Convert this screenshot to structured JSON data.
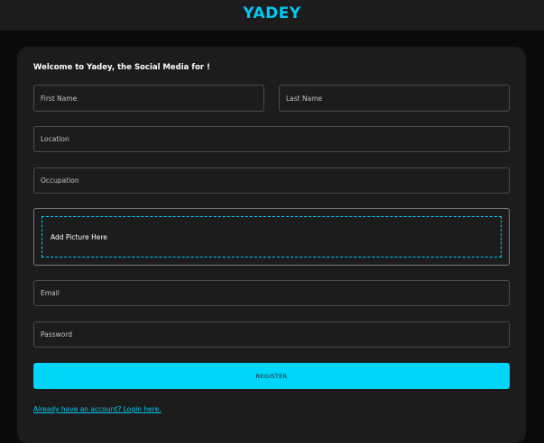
{
  "header": {
    "brand": "YADEY"
  },
  "form": {
    "welcome": "Welcome to Yadey, the Social Media for !",
    "first_name_placeholder": "First Name",
    "last_name_placeholder": "Last Name",
    "location_placeholder": "Location",
    "occupation_placeholder": "Occupation",
    "picture_label": "Add Picture Here",
    "email_placeholder": "Email",
    "password_placeholder": "Password",
    "register_label": "REGISTER",
    "login_link": "Already have an account? Login here."
  },
  "colors": {
    "accent": "#00c9f0",
    "button": "#00d5fa",
    "card_bg": "#1c1c1c",
    "page_bg": "#0a0a0a"
  }
}
